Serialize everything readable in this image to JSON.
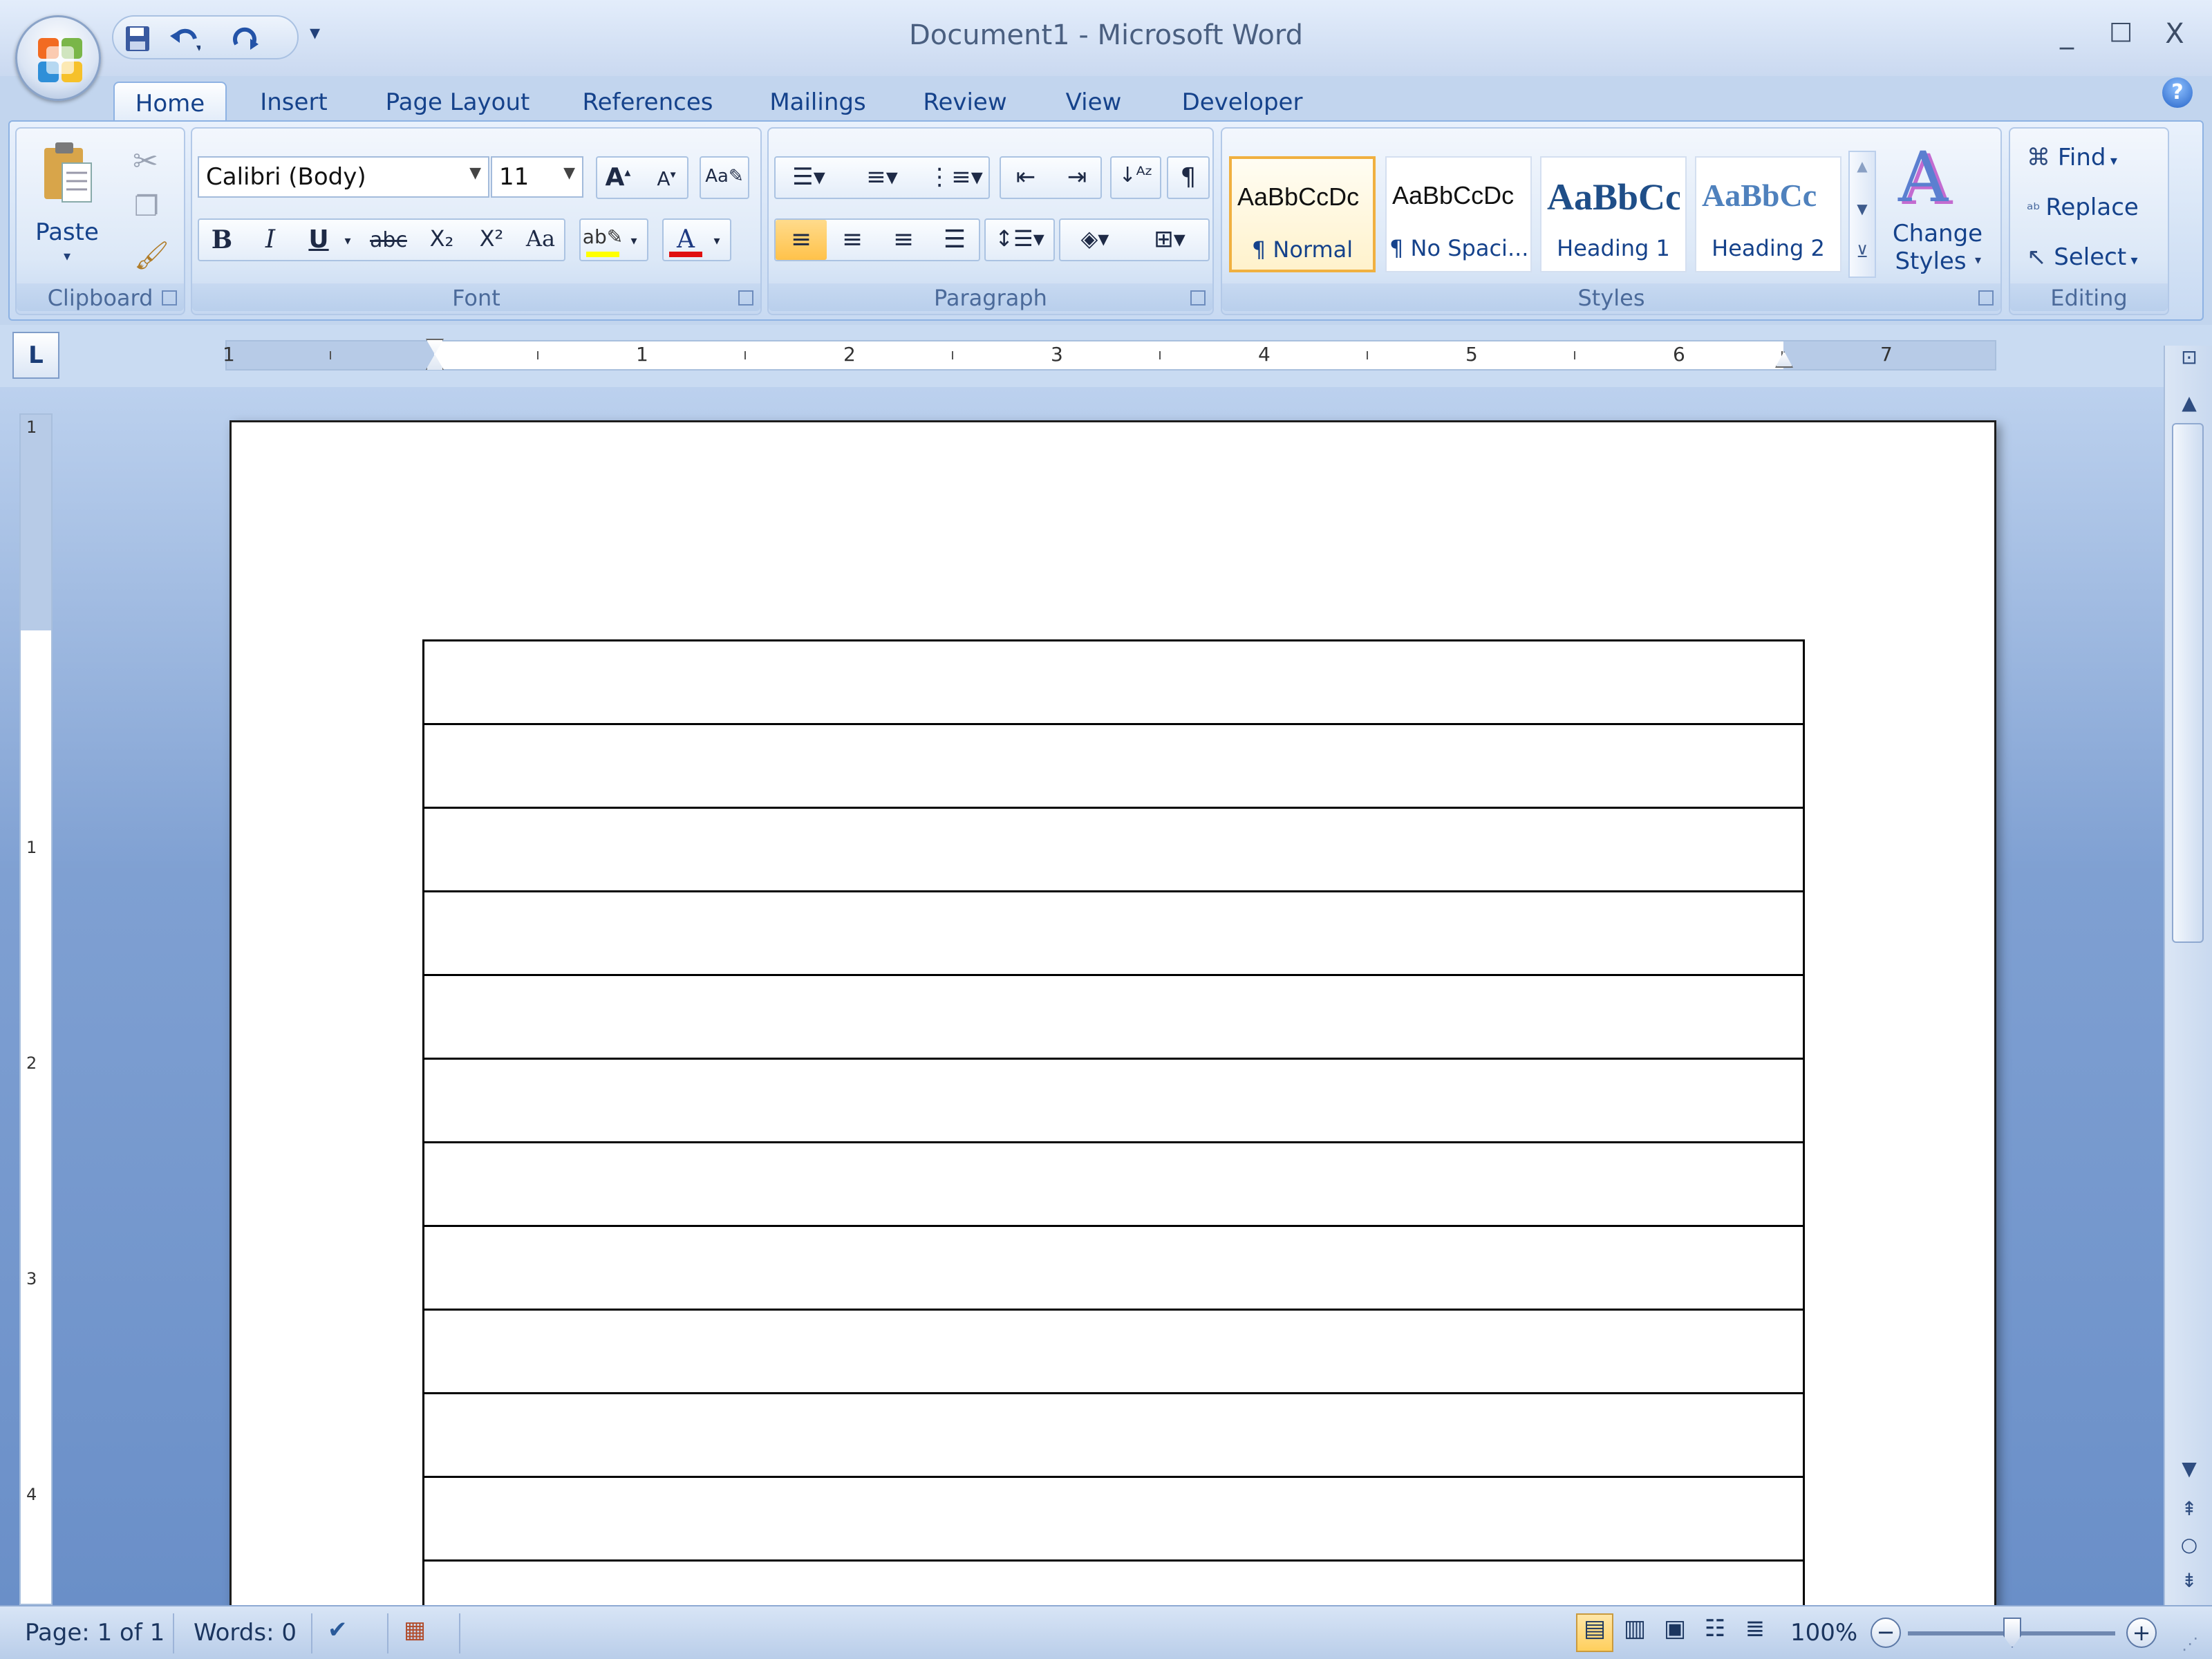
{
  "window": {
    "title": "Document1 - Microsoft Word",
    "controls": [
      "_",
      "□",
      "X"
    ]
  },
  "quick_access": {
    "icons": [
      "save-icon",
      "undo-icon",
      "redo-icon",
      "customize-qat-icon"
    ]
  },
  "tabs": [
    "Home",
    "Insert",
    "Page Layout",
    "References",
    "Mailings",
    "Review",
    "View",
    "Developer"
  ],
  "active_tab": "Home",
  "ribbon": {
    "clipboard": {
      "label": "Clipboard",
      "paste": "Paste"
    },
    "font": {
      "label": "Font",
      "font_name": "Calibri (Body)",
      "font_size": "11",
      "buttons": [
        "B",
        "I",
        "U",
        "abc",
        "X₂",
        "X²",
        "Aa"
      ]
    },
    "paragraph": {
      "label": "Paragraph"
    },
    "styles": {
      "label": "Styles",
      "tiles": [
        {
          "sample": "AaBbCcDc",
          "name": "¶ Normal"
        },
        {
          "sample": "AaBbCcDc",
          "name": "¶ No Spaci..."
        },
        {
          "sample": "AaBbCc",
          "name": "Heading 1"
        },
        {
          "sample": "AaBbCc",
          "name": "Heading 2"
        }
      ],
      "change_styles_line1": "Change",
      "change_styles_line2": "Styles"
    },
    "editing": {
      "label": "Editing",
      "find": "Find",
      "replace": "Replace",
      "select": "Select"
    }
  },
  "ruler": {
    "numbers": [
      "1",
      "1",
      "2",
      "3",
      "4",
      "5",
      "6",
      "7"
    ],
    "v_numbers": [
      "1",
      "1",
      "2",
      "3",
      "4"
    ]
  },
  "document": {
    "table_rows": 12
  },
  "status": {
    "page": "Page: 1 of 1",
    "words": "Words: 0",
    "zoom": "100%"
  },
  "colors": {
    "ribbon_text": "#15428b",
    "workspace": "#6a8fc8",
    "highlight": "#ffc24a"
  }
}
